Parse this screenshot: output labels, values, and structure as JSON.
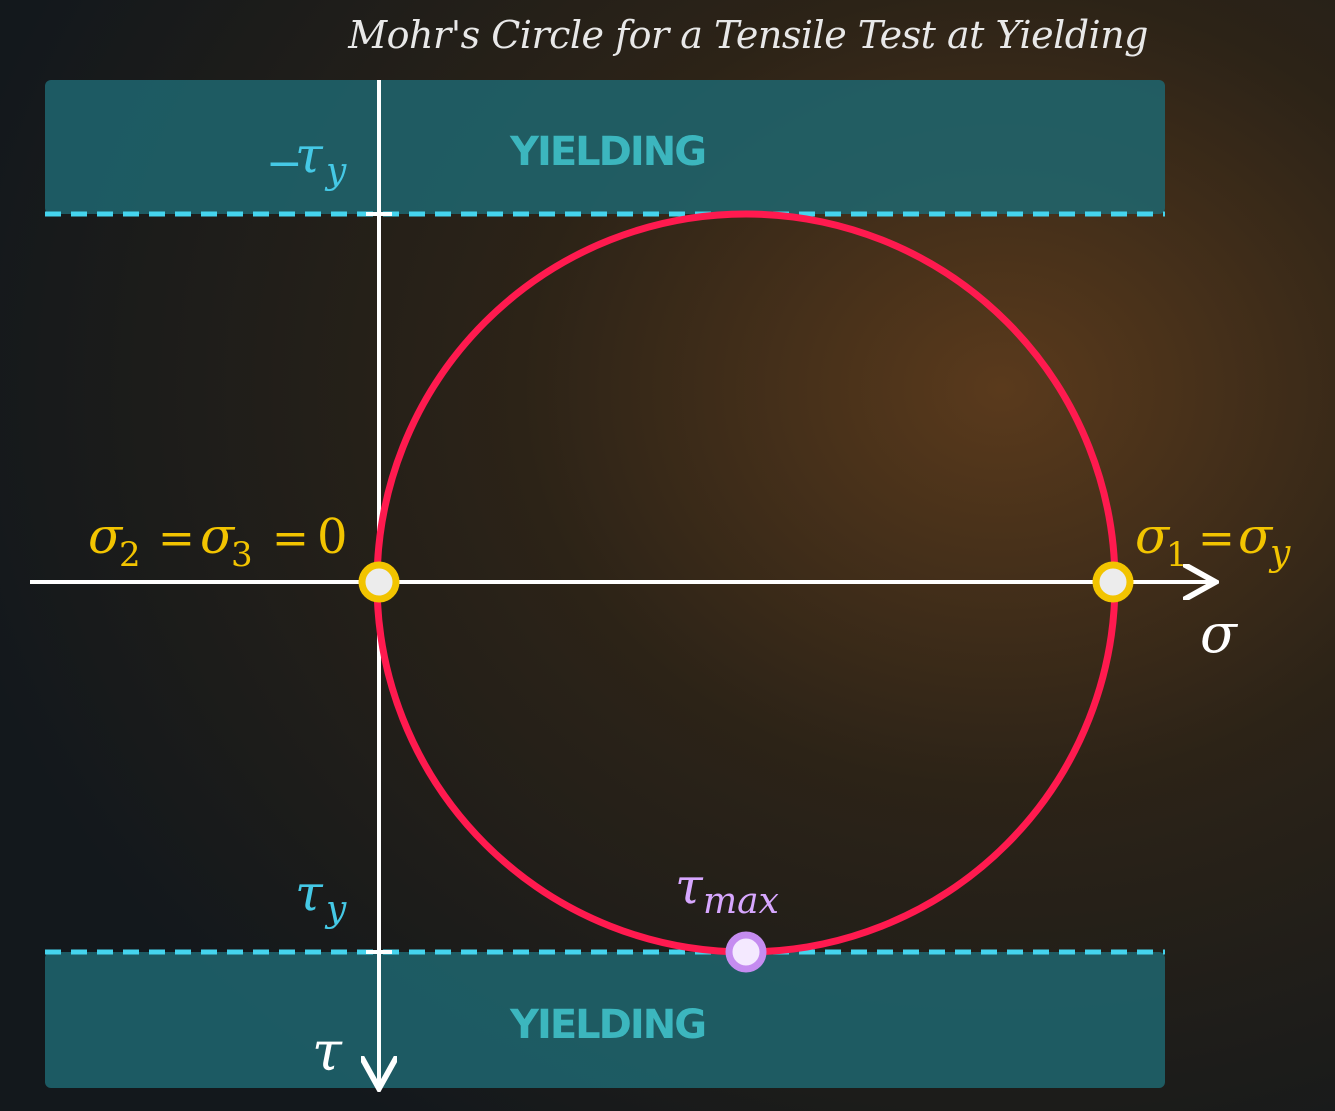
{
  "title": "Mohr's Circle for a Tensile Test at Yielding",
  "bands": {
    "top_label": "YIELDING",
    "bottom_label": "YIELDING"
  },
  "labels": {
    "neg_tau_y_sign": "−",
    "tau_symbol": "τ",
    "y_sub": "y",
    "sigma_symbol": "σ",
    "sub_1": "1",
    "sub_2": "2",
    "sub_3": "3",
    "equals": "=",
    "zero": "0",
    "max_sub": "max",
    "sigma_axis": "σ",
    "tau_axis": "τ"
  },
  "colors": {
    "band": "#1f6670",
    "dash": "#45d4ee",
    "circle": "#ff1a4f",
    "point_yellow": "#f2c400",
    "point_violet": "#c58cf0",
    "axis": "#ffffff"
  }
}
